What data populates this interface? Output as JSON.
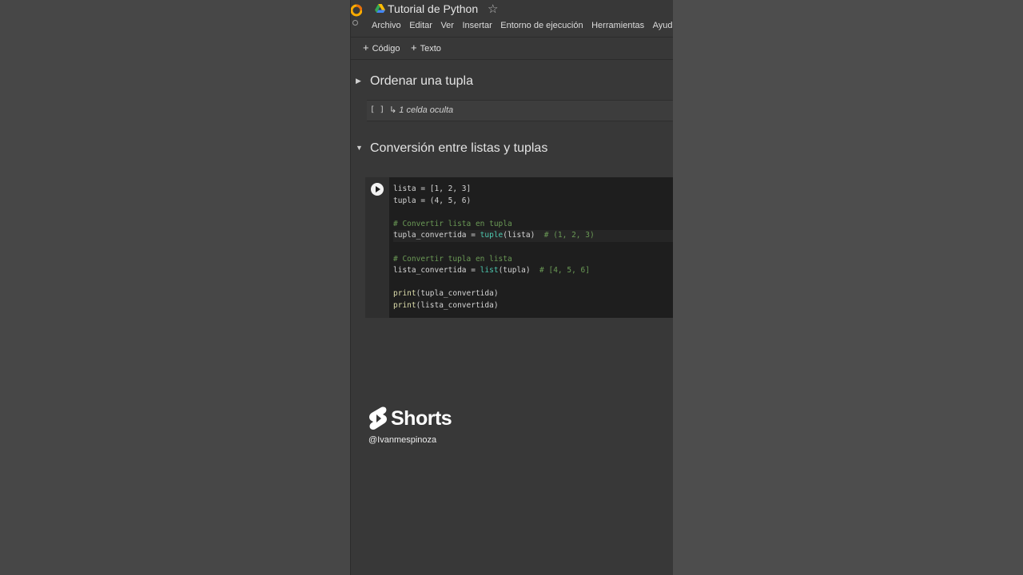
{
  "header": {
    "title": "Tutorial de Python",
    "menu": [
      "Archivo",
      "Editar",
      "Ver",
      "Insertar",
      "Entorno de ejecución",
      "Herramientas",
      "Ayuda"
    ]
  },
  "toolbar": {
    "code_label": "Código",
    "text_label": "Texto"
  },
  "sections": [
    {
      "title": "Ordenar una tupla",
      "hidden_label": "1 celda oculta"
    },
    {
      "title": "Conversión entre listas y tuplas"
    }
  ],
  "code": {
    "lines": [
      "lista = [1, 2, 3]",
      "tupla = (4, 5, 6)",
      "",
      "# Convertir lista en tupla",
      "tupla_convertida = tuple(lista)  # (1, 2, 3)",
      "",
      "# Convertir tupla en lista",
      "lista_convertida = list(tupla)  # [4, 5, 6]",
      "",
      "print(tupla_convertida)",
      "print(lista_convertida)"
    ]
  },
  "overlay": {
    "brand": "Shorts",
    "handle": "@Ivanmespinoza"
  },
  "colors": {
    "background": "#383838",
    "code_bg": "#1e1e1e",
    "comment": "#6a9955",
    "builtin": "#4ec9b0"
  }
}
